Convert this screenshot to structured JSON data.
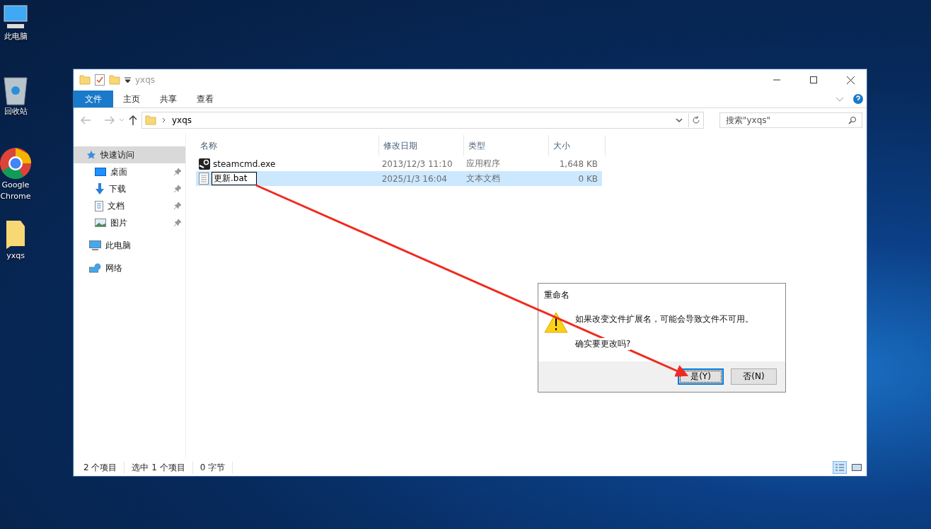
{
  "desktop_icons": [
    {
      "label": "此电脑",
      "kind": "computer"
    },
    {
      "label": "回收站",
      "kind": "recycle"
    },
    {
      "label": "Google Chrome",
      "kind": "chrome"
    },
    {
      "label": "yxqs",
      "kind": "folder"
    }
  ],
  "window": {
    "title": "yxqs",
    "ribbon_tabs": [
      {
        "label": "文件",
        "selected": true
      },
      {
        "label": "主页",
        "selected": false
      },
      {
        "label": "共享",
        "selected": false
      },
      {
        "label": "查看",
        "selected": false
      }
    ],
    "address": {
      "path": "yxqs"
    },
    "search": {
      "placeholder": "搜索\"yxqs\""
    },
    "sidebar": [
      {
        "label": "快速访问",
        "kind": "star",
        "selected": true,
        "children": [
          {
            "label": "桌面",
            "kind": "desktop",
            "pinned": true
          },
          {
            "label": "下载",
            "kind": "download",
            "pinned": true
          },
          {
            "label": "文档",
            "kind": "document",
            "pinned": true
          },
          {
            "label": "图片",
            "kind": "picture",
            "pinned": true
          }
        ]
      },
      {
        "label": "此电脑",
        "kind": "computer",
        "selected": false
      },
      {
        "label": "网络",
        "kind": "network",
        "selected": false
      }
    ],
    "columns": [
      "名称",
      "修改日期",
      "类型",
      "大小"
    ],
    "rows": [
      {
        "name": "steamcmd.exe",
        "date": "2013/12/3 11:10",
        "type": "应用程序",
        "size": "1,648 KB",
        "kind": "app",
        "selected": false,
        "editing": false
      },
      {
        "name": "更新.bat",
        "date": "2025/1/3 16:04",
        "type": "文本文档",
        "size": "0 KB",
        "kind": "text",
        "selected": true,
        "editing": true
      }
    ],
    "status": [
      "2 个项目",
      "选中 1 个项目",
      "0 字节"
    ]
  },
  "dialog": {
    "title": "重命名",
    "message": "如果改变文件扩展名，可能会导致文件不可用。",
    "question": "确实要更改吗?",
    "buttons": [
      {
        "label": "是(Y)",
        "selected": true
      },
      {
        "label": "否(N)",
        "selected": false
      }
    ]
  }
}
